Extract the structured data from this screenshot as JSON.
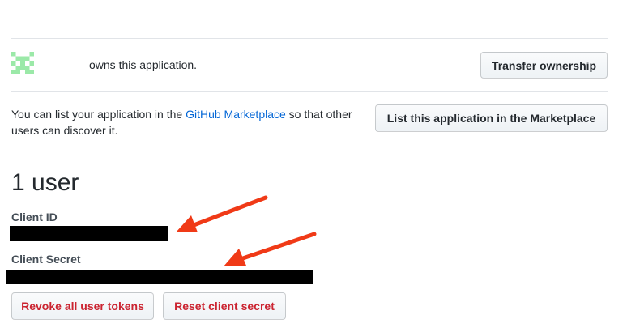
{
  "owner": {
    "text": "owns this application.",
    "avatar_color": "#9be9a8",
    "transfer_label": "Transfer ownership"
  },
  "marketplace": {
    "text_before": "You can list your application in the ",
    "link_text": "GitHub Marketplace",
    "text_after": " so that other users can discover it.",
    "button_label": "List this application in the Marketplace",
    "link_color": "#0366d6"
  },
  "users": {
    "count_label": "1 user"
  },
  "credentials": {
    "client_id_label": "Client ID",
    "client_secret_label": "Client Secret"
  },
  "actions": {
    "revoke_label": "Revoke all user tokens",
    "reset_label": "Reset client secret",
    "danger_color": "#cb2431"
  },
  "annotation": {
    "arrow_color": "#f03a17"
  }
}
